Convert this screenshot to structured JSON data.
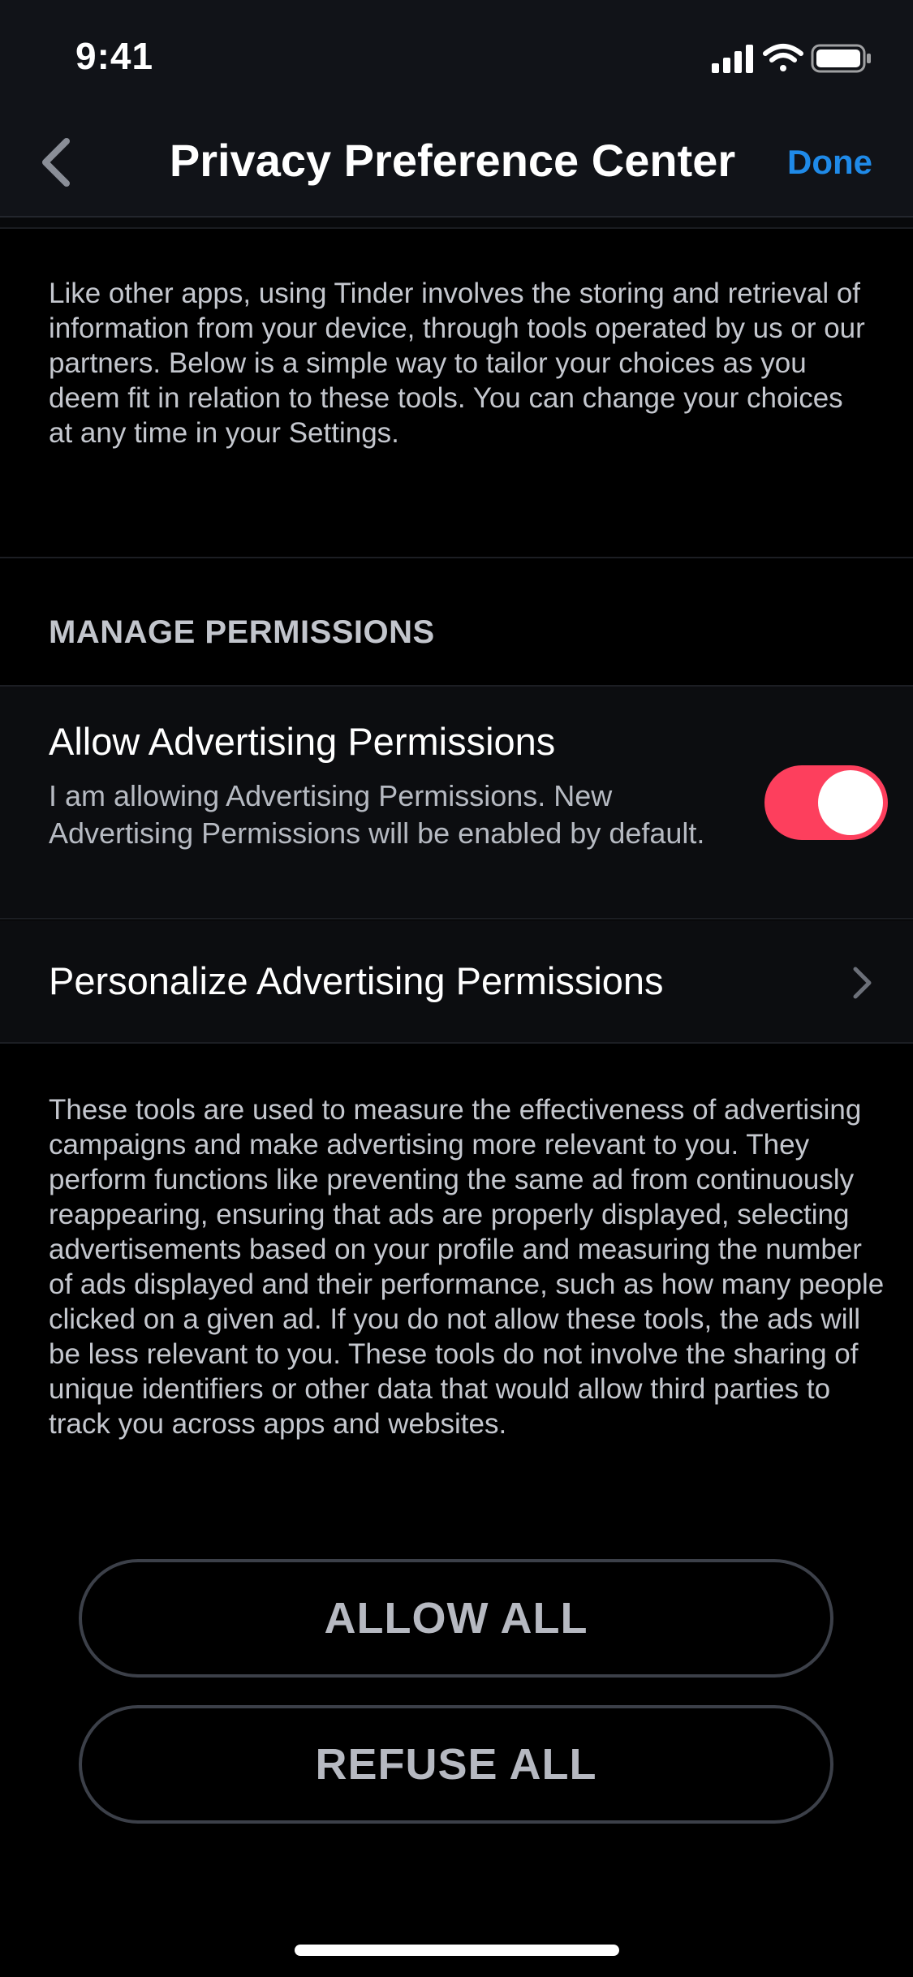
{
  "status_bar": {
    "time": "9:41",
    "icons": [
      "signal-icon",
      "wifi-icon",
      "battery-icon"
    ]
  },
  "nav": {
    "back_icon": "chevron-left-icon",
    "title": "Privacy Preference Center",
    "done_label": "Done"
  },
  "intro_text": "Like other apps, using Tinder involves the storing and retrieval of information from your device, through tools operated by us or our partners. Below is a simple way to tailor your choices as you deem fit in relation to these tools. You can change your choices at any time in your Settings.",
  "section_header": "MANAGE PERMISSIONS",
  "allow_advertising": {
    "title": "Allow Advertising Permissions",
    "description": "I am allowing Advertising Permissions. New Advertising Permissions will be enabled by default.",
    "toggle_on": true
  },
  "personalize": {
    "title": "Personalize Advertising Permissions",
    "icon": "chevron-right-icon"
  },
  "explanation_text": "These tools are used to measure the effectiveness of advertising campaigns and make advertising more relevant to you. They perform functions like preventing the same ad from continuously reappearing, ensuring that ads are properly displayed, selecting advertisements based on your profile and measuring the number of ads displayed and their performance, such as how many people clicked on a given ad. If you do not allow these tools, the ads will be less relevant to you. These tools do not involve the sharing of unique identifiers or other data that would allow third parties to track you across apps and websites.",
  "buttons": {
    "allow_all": "ALLOW ALL",
    "refuse_all": "REFUSE ALL"
  },
  "colors": {
    "accent_blue": "#1f8ae8",
    "toggle_on": "#fd3f5d",
    "background": "#000000",
    "bar_background": "#111318"
  }
}
